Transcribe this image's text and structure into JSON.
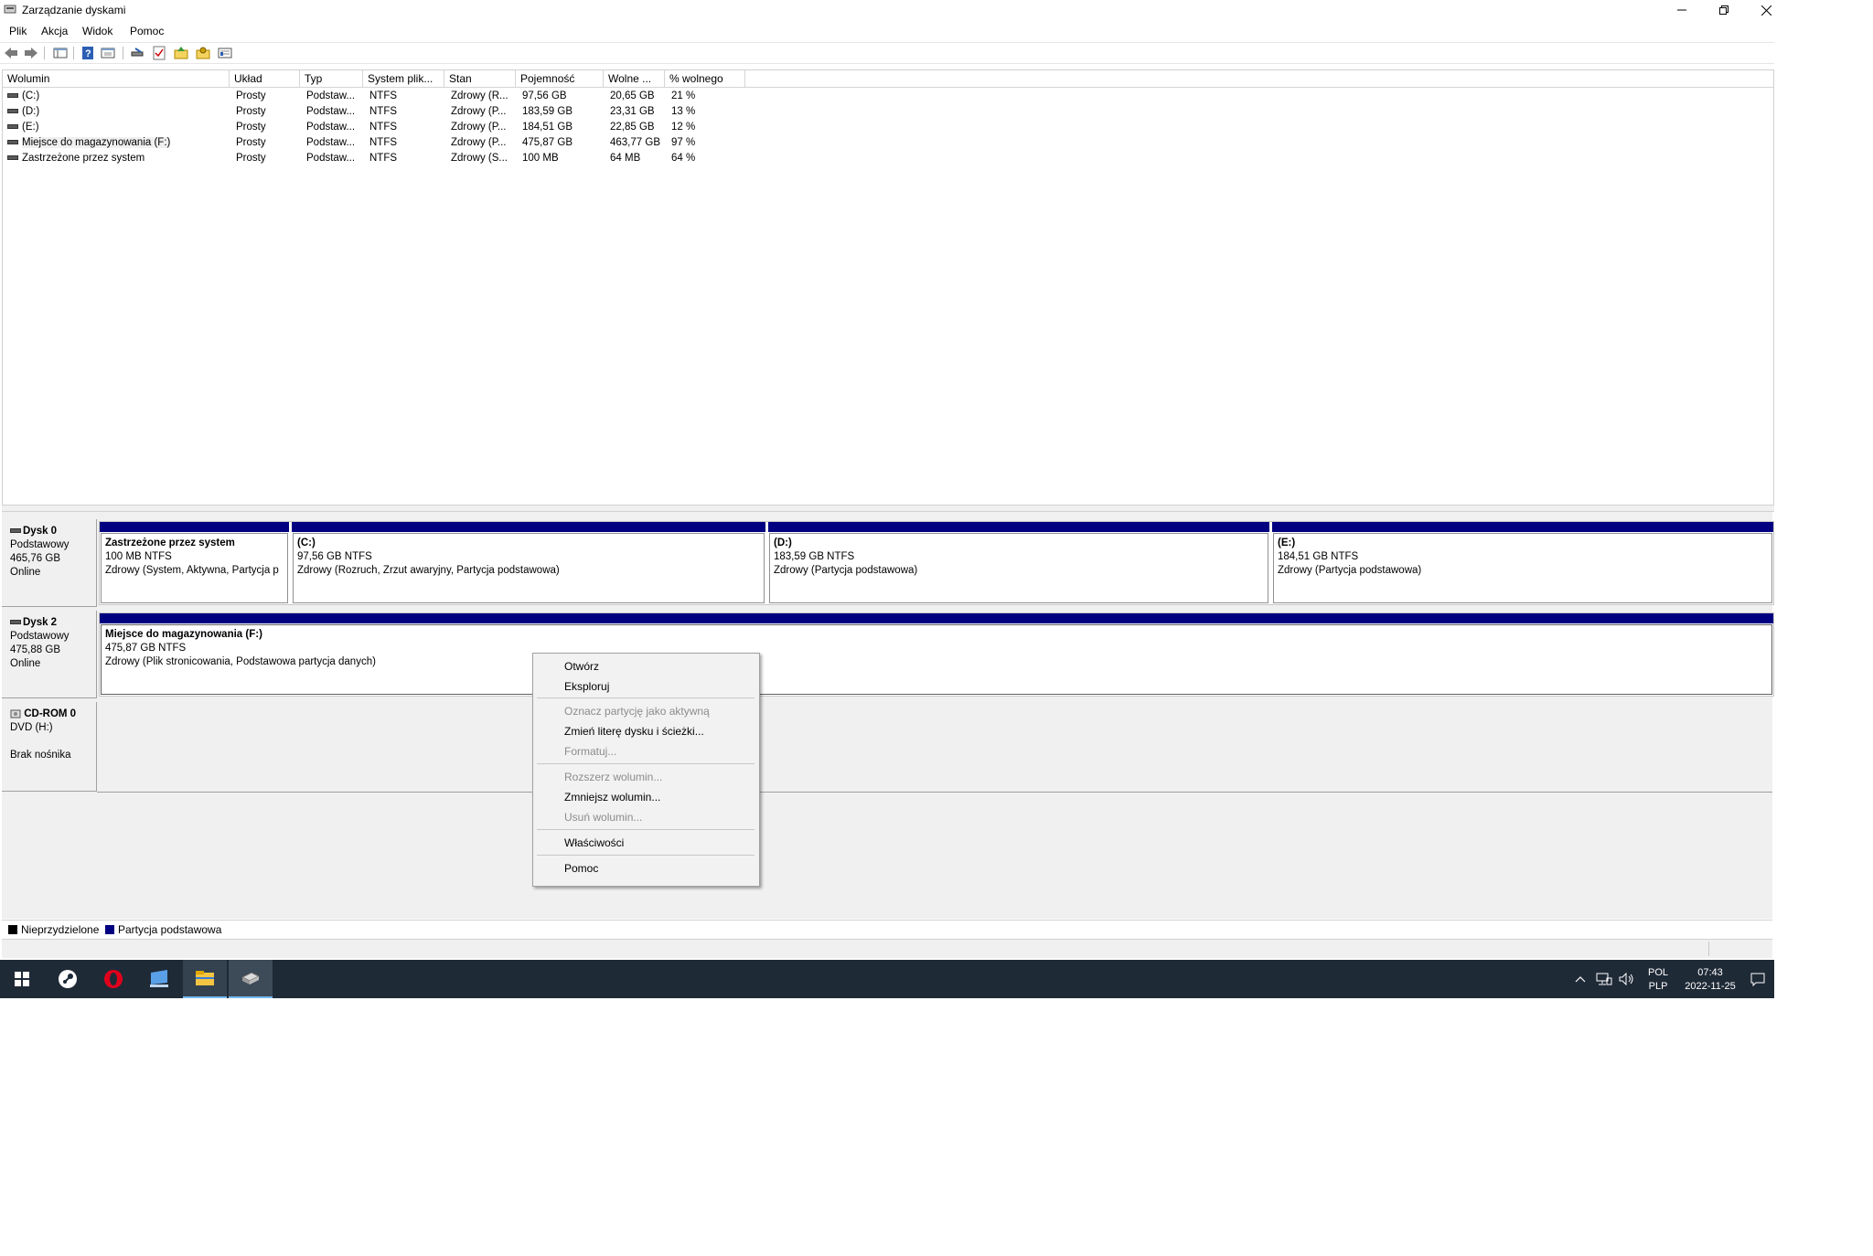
{
  "window": {
    "title": "Zarządzanie dyskami"
  },
  "menu": [
    "Plik",
    "Akcja",
    "Widok",
    "Pomoc"
  ],
  "volume_table": {
    "headers": [
      "Wolumin",
      "Układ",
      "Typ",
      "System plik...",
      "Stan",
      "Pojemność",
      "Wolne ...",
      "% wolnego"
    ],
    "rows": [
      [
        "(C:)",
        "Prosty",
        "Podstaw...",
        "NTFS",
        "Zdrowy (R...",
        "97,56 GB",
        "20,65 GB",
        "21 %"
      ],
      [
        "(D:)",
        "Prosty",
        "Podstaw...",
        "NTFS",
        "Zdrowy (P...",
        "183,59 GB",
        "23,31 GB",
        "13 %"
      ],
      [
        "(E:)",
        "Prosty",
        "Podstaw...",
        "NTFS",
        "Zdrowy (P...",
        "184,51 GB",
        "22,85 GB",
        "12 %"
      ],
      [
        "Miejsce do magazynowania (F:)",
        "Prosty",
        "Podstaw...",
        "NTFS",
        "Zdrowy (P...",
        "475,87 GB",
        "463,77 GB",
        "97 %"
      ],
      [
        "Zastrzeżone przez system",
        "Prosty",
        "Podstaw...",
        "NTFS",
        "Zdrowy (S...",
        "100 MB",
        "64 MB",
        "64 %"
      ]
    ]
  },
  "disks": [
    {
      "name": "Dysk 0",
      "type": "Podstawowy",
      "size": "465,76 GB",
      "status": "Online",
      "partitions": [
        {
          "name": "Zastrzeżone przez system",
          "size": "100 MB NTFS",
          "status": "Zdrowy (System, Aktywna, Partycja p"
        },
        {
          "name": "(C:)",
          "size": "97,56 GB NTFS",
          "status": "Zdrowy (Rozruch, Zrzut awaryjny, Partycja podstawowa)"
        },
        {
          "name": "(D:)",
          "size": "183,59 GB NTFS",
          "status": "Zdrowy (Partycja podstawowa)"
        },
        {
          "name": "(E:)",
          "size": "184,51 GB NTFS",
          "status": "Zdrowy (Partycja podstawowa)"
        }
      ]
    },
    {
      "name": "Dysk 2",
      "type": "Podstawowy",
      "size": "475,88 GB",
      "status": "Online",
      "partitions": [
        {
          "name": "Miejsce do magazynowania  (F:)",
          "size": "475,87 GB NTFS",
          "status": "Zdrowy (Plik stronicowania, Podstawowa partycja danych)"
        }
      ]
    },
    {
      "name": "CD-ROM 0",
      "type": "DVD (H:)",
      "status": "Brak nośnika"
    }
  ],
  "legend": [
    {
      "label": "Nieprzydzielone",
      "color": "#000000"
    },
    {
      "label": "Partycja podstawowa",
      "color": "#000080"
    }
  ],
  "context_menu": {
    "items": [
      {
        "label": "Otwórz",
        "enabled": true
      },
      {
        "label": "Eksploruj",
        "enabled": true
      },
      {
        "label": "Oznacz partycję jako aktywną",
        "enabled": false
      },
      {
        "label": "Zmień literę dysku i ścieżki...",
        "enabled": true
      },
      {
        "label": "Formatuj...",
        "enabled": false
      },
      {
        "label": "Rozszerz wolumin...",
        "enabled": false
      },
      {
        "label": "Zmniejsz wolumin...",
        "enabled": true
      },
      {
        "label": "Usuń wolumin...",
        "enabled": false
      },
      {
        "label": "Właściwości",
        "enabled": true
      },
      {
        "label": "Pomoc",
        "enabled": true
      }
    ]
  },
  "taskbar": {
    "apps": [
      "windows-start",
      "steam",
      "opera",
      "remote-desktop",
      "file-explorer",
      "disk-management"
    ],
    "lang": "POL",
    "layout": "PLP",
    "time": "07:43",
    "date": "2022-11-25"
  },
  "colors": {
    "primary_partition": "#000080",
    "taskbar": "#1f2a37"
  }
}
